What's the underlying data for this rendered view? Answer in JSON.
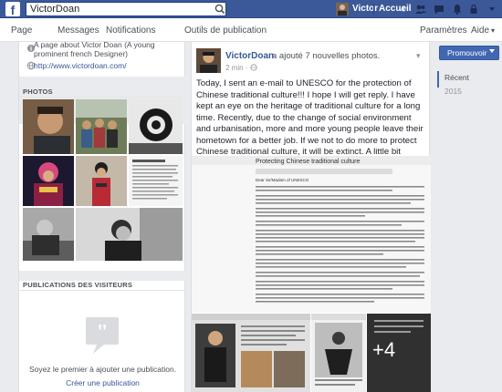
{
  "topbar": {
    "logo": "f",
    "search_value": "VictorDoan",
    "user_name": "Victor",
    "home_label": "Accueil",
    "home_count": "4"
  },
  "navbar": {
    "items": [
      "Page",
      "Messages",
      "Notifications",
      "Outils de publication"
    ],
    "settings_label": "Paramètres",
    "help_label": "Aide"
  },
  "about": {
    "description": "A page about Victor Doan (A young prominent french Designer)",
    "website": "http://www.victordoan.com/"
  },
  "photos": {
    "header": "PHOTOS"
  },
  "visitors": {
    "header": "PUBLICATIONS DES VISITEURS",
    "empty_text": "Soyez le premier à ajouter une publication.",
    "create_link": "Créer une publication"
  },
  "post": {
    "author": "VictorDoan",
    "action": "a ajouté 7 nouvelles photos.",
    "time": "2 min",
    "body": "Today, I sent an e-mail to UNESCO for the protection of Chinese traditional culture!!! I hope I will get reply. I have kept an eye on the heritage of traditional culture for a long time. Recently, due to the change of social environment and urbanisation, more and more young people leave their hometown for a better job. If we not to do more to protect Chinese traditional culture, it will be extinct. A little bit consensus and actions from you and me is the key to solve the cultural heritage problem. I hope you can join us to protect the endangered traditional culture in your own ways.",
    "more_photos": "+4",
    "doc_title": "Protecting Chinese traditional culture",
    "doc_greeting": "Dear Sir/Madam of UNESCO"
  },
  "sidebar": {
    "promote_label": "Promouvoir",
    "timeline": [
      "Récent",
      "2015"
    ]
  },
  "colors": {
    "brand": "#3b5998",
    "link": "#365899",
    "background": "#e9ebee"
  }
}
